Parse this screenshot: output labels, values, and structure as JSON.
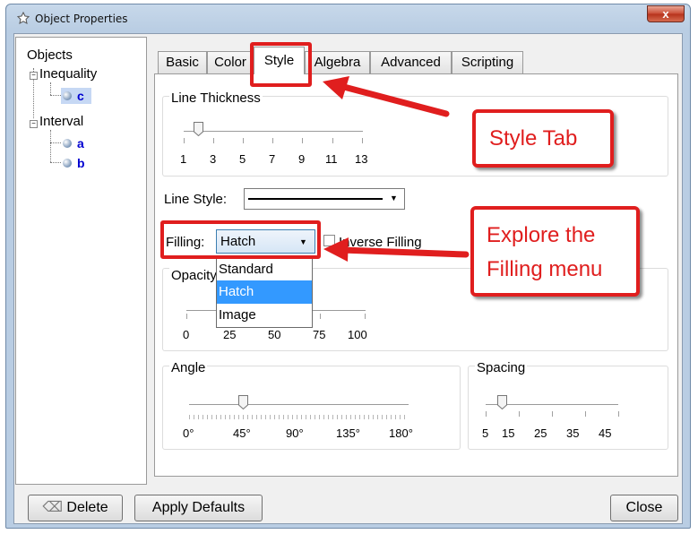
{
  "window": {
    "title": "Object Properties",
    "close_glyph": "x"
  },
  "tree": {
    "root": "Objects",
    "groups": [
      {
        "label": "Inequality",
        "items": [
          "c"
        ]
      },
      {
        "label": "Interval",
        "items": [
          "a",
          "b"
        ]
      }
    ]
  },
  "tabs": [
    "Basic",
    "Color",
    "Style",
    "Algebra",
    "Advanced",
    "Scripting"
  ],
  "active_tab": "Style",
  "line_thickness": {
    "title": "Line Thickness",
    "ticks": [
      "1",
      "3",
      "5",
      "7",
      "9",
      "11",
      "13"
    ],
    "value": 3
  },
  "line_style": {
    "label": "Line Style:"
  },
  "filling": {
    "label": "Filling:",
    "value": "Hatch",
    "options": [
      "Standard",
      "Hatch",
      "Image"
    ],
    "selected_option": "Hatch",
    "inverse_label": "Inverse Filling"
  },
  "opacity": {
    "title": "Opacity",
    "ticks": [
      "0",
      "25",
      "50",
      "75",
      "100"
    ]
  },
  "angle": {
    "title": "Angle",
    "ticks": [
      "0°",
      "45°",
      "90°",
      "135°",
      "180°"
    ],
    "value": "45°"
  },
  "spacing": {
    "title": "Spacing",
    "ticks": [
      "5",
      "15",
      "25",
      "35",
      "45"
    ],
    "value": 5
  },
  "buttons": {
    "delete": "Delete",
    "apply_defaults": "Apply Defaults",
    "close": "Close"
  },
  "annotations": {
    "style_tab": "Style Tab",
    "filling_line1": "Explore the",
    "filling_line2": "Filling menu"
  },
  "colors": {
    "annotation_red": "#e01e1e",
    "selection_blue": "#3399ff",
    "leaf_blue": "#0000d0"
  }
}
